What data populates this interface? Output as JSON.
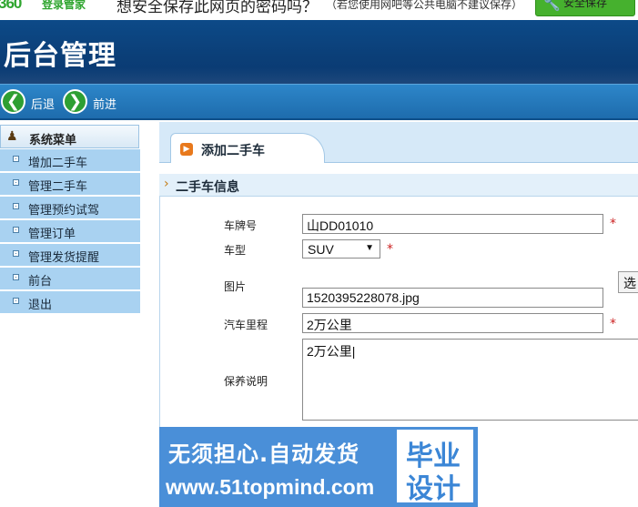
{
  "password_bar": {
    "logo": "360",
    "logo_sub": "登录管家",
    "question": "想安全保存此网页的密码吗？",
    "note": "（若您使用网吧等公共电脑不建议保存）",
    "save_label": "安全保存"
  },
  "header": {
    "title": "后台管理"
  },
  "nav": {
    "back_label": "后退",
    "forward_label": "前进"
  },
  "sidebar": {
    "title": "系统菜单",
    "items": [
      {
        "label": "增加二手车"
      },
      {
        "label": "管理二手车"
      },
      {
        "label": "管理预约试驾"
      },
      {
        "label": "管理订单"
      },
      {
        "label": "管理发货提醒"
      },
      {
        "label": "前台"
      },
      {
        "label": "退出"
      }
    ]
  },
  "main": {
    "tab_label": "添加二手车",
    "section_title": "二手车信息",
    "form": {
      "plate_label": "车牌号",
      "plate_value": "山DD01010",
      "model_label": "车型",
      "model_value": "SUV",
      "image_label": "图片",
      "image_value": "1520395228078.jpg",
      "choose_label": "选",
      "mileage_label": "汽车里程",
      "mileage_value": "2万公里",
      "desc_label": "保养说明",
      "desc_value": "2万公里|",
      "required_mark": "*"
    }
  },
  "watermark": {
    "line1": "无须担心.自动发货",
    "line2": "www.51topmind.com",
    "badge_line1": "毕业",
    "badge_line2": "设计"
  },
  "colors": {
    "header": "#0b3f78",
    "navbar": "#1e6cad",
    "sidebar_item": "#a9d2f1",
    "watermark": "#4a8fd8",
    "save_button": "#46b12e"
  }
}
